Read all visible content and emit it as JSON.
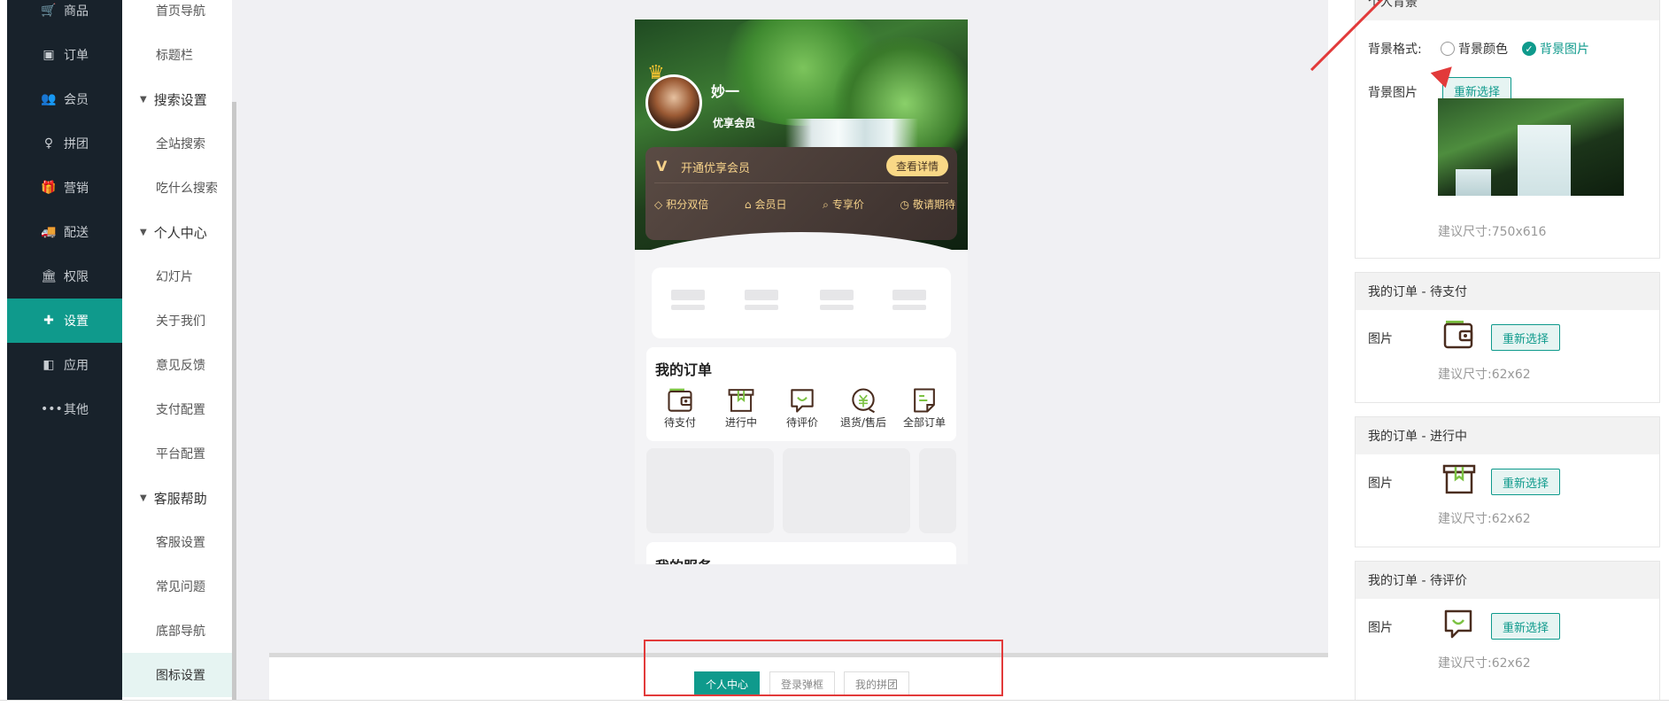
{
  "nav": {
    "items": [
      {
        "icon": "cart-icon",
        "glyph": "🛒",
        "label": "商品"
      },
      {
        "icon": "order-icon",
        "glyph": "▣",
        "label": "订单"
      },
      {
        "icon": "members-icon",
        "glyph": "👥",
        "label": "会员"
      },
      {
        "icon": "group-buy-icon",
        "glyph": "♀",
        "label": "拼团"
      },
      {
        "icon": "gift-icon",
        "glyph": "🎁",
        "label": "营销"
      },
      {
        "icon": "truck-icon",
        "glyph": "🚚",
        "label": "配送"
      },
      {
        "icon": "bank-icon",
        "glyph": "🏛",
        "label": "权限"
      },
      {
        "icon": "puzzle-icon",
        "glyph": "✚",
        "label": "设置"
      },
      {
        "icon": "app-icon",
        "glyph": "◧",
        "label": "应用"
      },
      {
        "icon": "more-icon",
        "glyph": "•••",
        "label": "其他"
      }
    ],
    "active_index": 7
  },
  "submenu": {
    "items": [
      {
        "type": "item",
        "label": "首页导航"
      },
      {
        "type": "item",
        "label": "标题栏"
      },
      {
        "type": "group",
        "label": "搜索设置"
      },
      {
        "type": "item",
        "label": "全站搜索"
      },
      {
        "type": "item",
        "label": "吃什么搜索"
      },
      {
        "type": "group",
        "label": "个人中心"
      },
      {
        "type": "item",
        "label": "幻灯片"
      },
      {
        "type": "item",
        "label": "关于我们"
      },
      {
        "type": "item",
        "label": "意见反馈"
      },
      {
        "type": "item",
        "label": "支付配置"
      },
      {
        "type": "item",
        "label": "平台配置"
      },
      {
        "type": "group",
        "label": "客服帮助"
      },
      {
        "type": "item",
        "label": "客服设置"
      },
      {
        "type": "item",
        "label": "常见问题"
      },
      {
        "type": "item",
        "label": "底部导航"
      },
      {
        "type": "item",
        "label": "图标设置",
        "active": true
      }
    ]
  },
  "preview": {
    "user_name": "妙一",
    "user_level": "优享会员",
    "vip": {
      "mark": "V",
      "title": "开通优享会员",
      "detail_button": "查看详情",
      "perks": [
        {
          "icon": "diamond-icon",
          "glyph": "◇",
          "label": "积分双倍"
        },
        {
          "icon": "lock-icon",
          "glyph": "⌂",
          "label": "会员日"
        },
        {
          "icon": "tag-icon",
          "glyph": "⌕",
          "label": "专享价"
        },
        {
          "icon": "clock-icon",
          "glyph": "◷",
          "label": "敬请期待"
        }
      ]
    },
    "orders": {
      "title": "我的订单",
      "items": [
        {
          "icon": "wallet-icon",
          "label": "待支付"
        },
        {
          "icon": "box-icon",
          "label": "进行中"
        },
        {
          "icon": "comment-icon",
          "label": "待评价"
        },
        {
          "icon": "refund-icon",
          "label": "退货/售后"
        },
        {
          "icon": "document-icon",
          "label": "全部订单"
        }
      ]
    },
    "services_title": "我的服务"
  },
  "tabs": {
    "items": [
      {
        "label": "个人中心",
        "active": true
      },
      {
        "label": "登录弹框",
        "active": false
      },
      {
        "label": "我的拼团",
        "active": false
      }
    ]
  },
  "panel": {
    "bg_section": {
      "title": "个人背景",
      "format_label": "背景格式:",
      "option_color": "背景颜色",
      "option_image": "背景图片",
      "selected": "背景图片",
      "image_label": "背景图片",
      "reselect": "重新选择",
      "hint": "建议尺寸:750x616"
    },
    "icon_sections": [
      {
        "title": "我的订单 - 待支付",
        "label": "图片",
        "reselect": "重新选择",
        "hint": "建议尺寸:62x62",
        "icon": "wallet-icon"
      },
      {
        "title": "我的订单 - 进行中",
        "label": "图片",
        "reselect": "重新选择",
        "hint": "建议尺寸:62x62",
        "icon": "box-icon"
      },
      {
        "title": "我的订单 - 待评价",
        "label": "图片",
        "reselect": "重新选择",
        "hint": "建议尺寸:62x62",
        "icon": "comment-icon"
      }
    ]
  },
  "colors": {
    "accent": "#0f9a8c",
    "sidebar_bg": "#18222b",
    "annotation_red": "#e23a3a",
    "vip_gold": "#f6d28a"
  }
}
